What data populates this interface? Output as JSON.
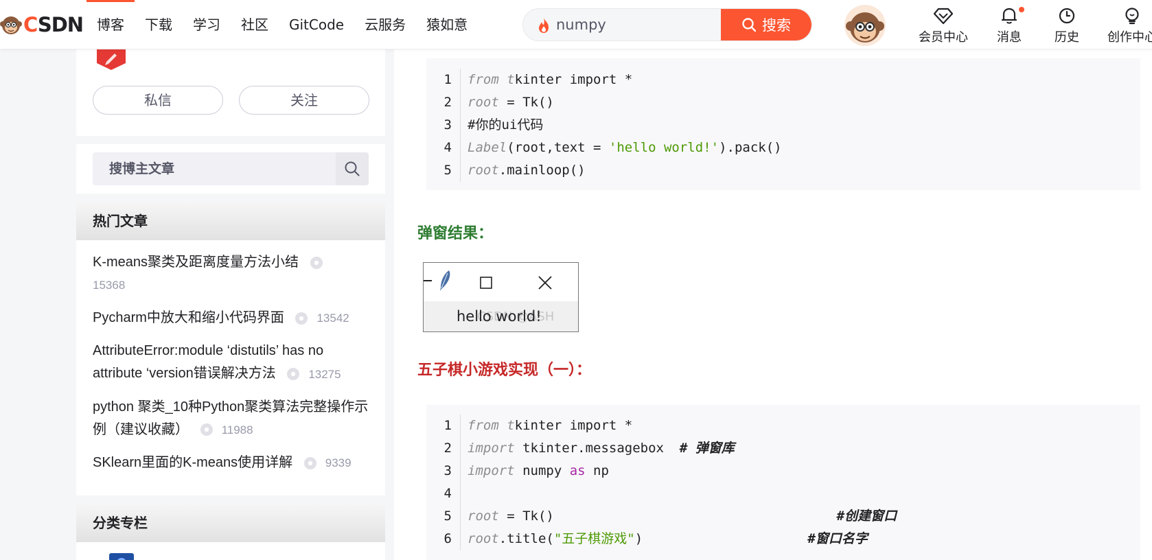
{
  "colors": {
    "brand": "#fc5531",
    "green_heading": "#2e7d32",
    "red_heading": "#c62828"
  },
  "header": {
    "logo_text_c": "C",
    "logo_text_rest": "SDN",
    "nav": [
      "博客",
      "下载",
      "学习",
      "社区",
      "GitCode",
      "云服务",
      "猿如意"
    ],
    "search": {
      "value": "numpy",
      "button_label": "搜索"
    },
    "tools": [
      {
        "label": "会员中心",
        "icon": "diamond-icon"
      },
      {
        "label": "消息",
        "icon": "bell-icon"
      },
      {
        "label": "历史",
        "icon": "clock-icon"
      },
      {
        "label": "创作中心",
        "icon": "bulb-icon"
      }
    ]
  },
  "sidebar": {
    "message_button": "私信",
    "follow_button": "关注",
    "blog_search_placeholder": "搜博主文章",
    "hot_title": "热门文章",
    "hot_articles": [
      {
        "title": "K-means聚类及距离度量方法小结",
        "views": "15368"
      },
      {
        "title": "Pycharm中放大和缩小代码界面",
        "views": "13542"
      },
      {
        "title": "AttributeError:module ‘distutils’ has no attribute ‘version错误解决方法",
        "views": "13275"
      },
      {
        "title": "python 聚类_10种Python聚类算法完整操作示例（建议收藏）",
        "views": "11988"
      },
      {
        "title": "SKlearn里面的K-means使用详解",
        "views": "9339"
      }
    ],
    "column_title": "分类专栏"
  },
  "content": {
    "popup_heading": "弹窗结果：",
    "gomoku_heading": "五子棋小游戏实现（一）：",
    "tk_window_label": "hello world!",
    "tk_window_faint_text": "CSDN @ASH",
    "code1": {
      "line_numbers": [
        "1",
        "2",
        "3",
        "4",
        "5"
      ],
      "l1": {
        "a": "from ",
        "b": "t",
        "c": "kinter import *"
      },
      "l2": {
        "a": "root",
        "b": " = Tk()"
      },
      "l3": {
        "a": "#你的ui代码"
      },
      "l4": {
        "a": "Label",
        "b": "(root,text = ",
        "c": "'hello world!'",
        "d": ").pack()"
      },
      "l5": {
        "a": "root",
        "b": ".mainloop()"
      }
    },
    "code2": {
      "line_numbers": [
        "1",
        "2",
        "3",
        "4",
        "5",
        "6"
      ],
      "l1": {
        "a": "from ",
        "b": "t",
        "c": "kinter import *"
      },
      "l2": {
        "a": "import",
        "b": " tkinter.messagebox  ",
        "c": "# 弹窗库"
      },
      "l3": {
        "a": "import",
        "b": " numpy ",
        "c": "as",
        "d": " np"
      },
      "l5": {
        "a": "root",
        "b": " = Tk()                                    ",
        "c": "#创建窗口"
      },
      "l6": {
        "a": "root",
        "b": ".title(",
        "c": "\"五子棋游戏\"",
        "d": ")                     ",
        "e": "#窗口名字"
      }
    }
  }
}
